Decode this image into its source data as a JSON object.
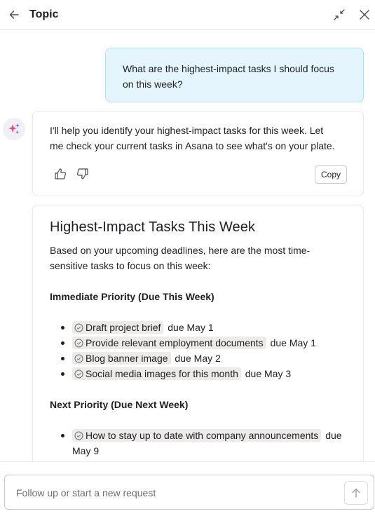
{
  "header": {
    "title": "Topic"
  },
  "user_message": "What are the highest-impact tasks I should focus on this week?",
  "ai_message": {
    "text": "I'll help you identify your highest-impact tasks for this week. Let me check your current tasks in Asana to see what's on your plate.",
    "copy_label": "Copy"
  },
  "result": {
    "title": "Highest-Impact Tasks This Week",
    "intro": "Based on your upcoming deadlines, here are the most time-sensitive tasks to focus on this week:",
    "sections": [
      {
        "heading": "Immediate Priority (Due This Week)",
        "tasks": [
          {
            "name": "Draft project brief",
            "due": "due May 1"
          },
          {
            "name": "Provide relevant employment documents",
            "due": "due May 1"
          },
          {
            "name": "Blog banner image",
            "due": "due May 2"
          },
          {
            "name": "Social media images for this month",
            "due": "due May 3"
          }
        ]
      },
      {
        "heading": "Next Priority (Due Next Week)",
        "tasks": [
          {
            "name": "How to stay up to date with company announcements",
            "due": "due May 9"
          }
        ]
      }
    ]
  },
  "composer": {
    "placeholder": "Follow up or start a new request"
  },
  "colors": {
    "user_bubble": "#e4f5fd",
    "user_bubble_border": "#b6e0f4",
    "chip": "#edebe9",
    "ai_sparkle_pink": "#e8437a",
    "ai_sparkle_blue": "#4a6cf0"
  },
  "icons": [
    "arrow-left-icon",
    "collapse-icon",
    "close-icon",
    "sparkle-icon",
    "thumbs-up-icon",
    "thumbs-down-icon",
    "check-circle-icon",
    "arrow-up-icon"
  ]
}
